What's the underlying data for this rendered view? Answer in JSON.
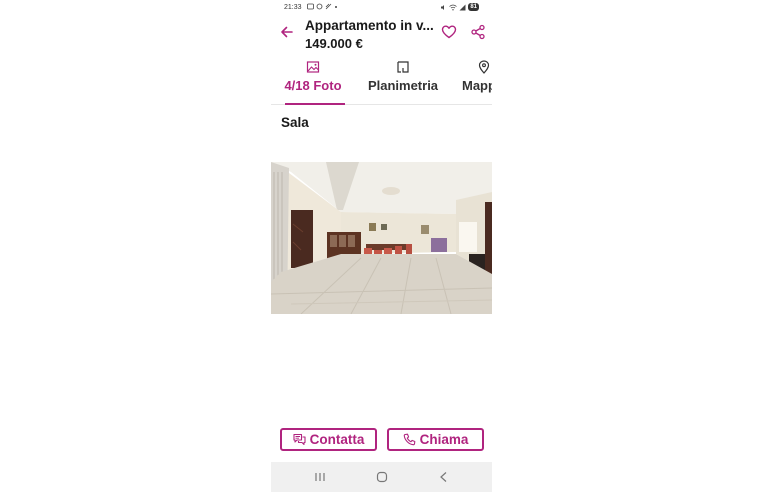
{
  "status_bar": {
    "time": "21:33",
    "battery": "81"
  },
  "header": {
    "title": "Appartamento in v...",
    "price": "149.000 €"
  },
  "tabs": [
    {
      "label": "4/18 Foto",
      "icon": "image-icon",
      "active": true
    },
    {
      "label": "Planimetria",
      "icon": "floorplan-icon",
      "active": false
    },
    {
      "label": "Mappa",
      "icon": "map-pin-icon",
      "active": false
    }
  ],
  "section": {
    "title": "Sala"
  },
  "actions": {
    "contact_label": "Contatta",
    "call_label": "Chiama"
  },
  "colors": {
    "accent": "#b0247f"
  }
}
